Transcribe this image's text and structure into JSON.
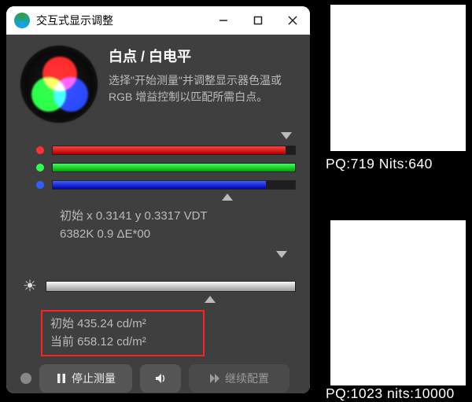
{
  "window": {
    "title": "交互式显示调整"
  },
  "head": {
    "title": "白点 / 白电平",
    "desc_line1": "选择\"开始测量\"并调整显示器色温或",
    "desc_line2": "RGB 增益控制以匹配所需白点。"
  },
  "rgb": {
    "red": {
      "level_pct": 96
    },
    "green": {
      "level_pct": 100
    },
    "blue": {
      "level_pct": 88
    }
  },
  "rgb_target_marker_pct": 96,
  "rgb_current_marker_pct": 71,
  "colorimetry": {
    "line1": "初始 x 0.3141 y 0.3317 VDT",
    "line2": "6382K 0.9 ΔE*00"
  },
  "brightness": {
    "target_marker_pct": 96,
    "current_marker_pct": 67,
    "initial_label": "初始 435.24 cd/m²",
    "current_label": "当前 658.12 cd/m²"
  },
  "footer": {
    "stop_label": "停止测量",
    "continue_label": "继续配置"
  },
  "patches": {
    "p1": "PQ:719  Nits:640",
    "p2": "PQ:1023 nits:10000"
  }
}
